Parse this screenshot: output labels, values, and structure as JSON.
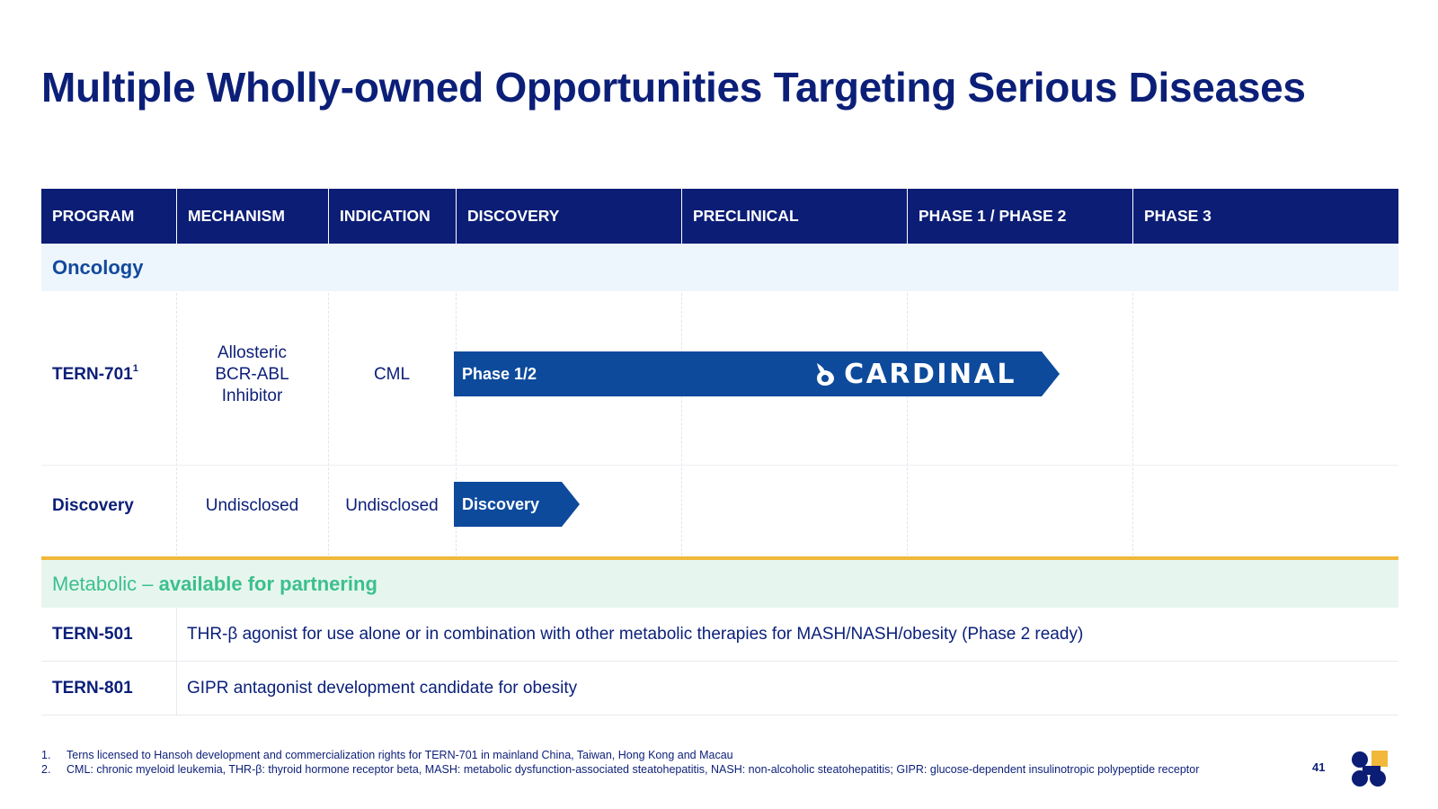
{
  "title": "Multiple Wholly-owned Opportunities Targeting Serious Diseases",
  "headers": [
    "PROGRAM",
    "MECHANISM",
    "INDICATION",
    "DISCOVERY",
    "PRECLINICAL",
    "PHASE 1 / PHASE 2",
    "PHASE 3"
  ],
  "oncology": {
    "label": "Oncology",
    "rows": [
      {
        "program": "TERN-701",
        "program_sup": "1",
        "mechanism_lines": [
          "Allosteric",
          "BCR-ABL",
          "Inhibitor"
        ],
        "indication": "CML",
        "bar_label": "Phase 1/2",
        "bar_partner": "CARDINAL",
        "stage_progress": "Phase 1 / Phase 2"
      },
      {
        "program": "Discovery",
        "mechanism": "Undisclosed",
        "indication": "Undisclosed",
        "bar_label": "Discovery",
        "stage_progress": "Discovery"
      }
    ]
  },
  "metabolic": {
    "label_plain": "Metabolic – ",
    "label_bold": "available for partnering",
    "rows": [
      {
        "program": "TERN-501",
        "description": "THR-β agonist for use alone or in combination with other metabolic therapies for MASH/NASH/obesity (Phase 2 ready)"
      },
      {
        "program": "TERN-801",
        "description": "GIPR antagonist development candidate for obesity"
      }
    ]
  },
  "footnotes": [
    {
      "num": "1.",
      "text": "Terns licensed to Hansoh development and commercialization rights for TERN-701 in mainland China, Taiwan, Hong Kong and Macau"
    },
    {
      "num": "2.",
      "text": "CML: chronic myeloid leukemia, THR-β: thyroid hormone receptor beta, MASH: metabolic dysfunction-associated steatohepatitis, NASH: non-alcoholic steatohepatitis; GIPR: glucose-dependent insulinotropic polypeptide receptor"
    }
  ],
  "page_number": "41",
  "colors": {
    "navy": "#0b1d75",
    "bar_blue": "#0d4a9c",
    "oncology_band": "#eef6fd",
    "metabolic_band": "#e6f6ef",
    "metabolic_text": "#3cbf8e",
    "divider_gold": "#f2b83a",
    "logo_yellow": "#f2b83a"
  }
}
